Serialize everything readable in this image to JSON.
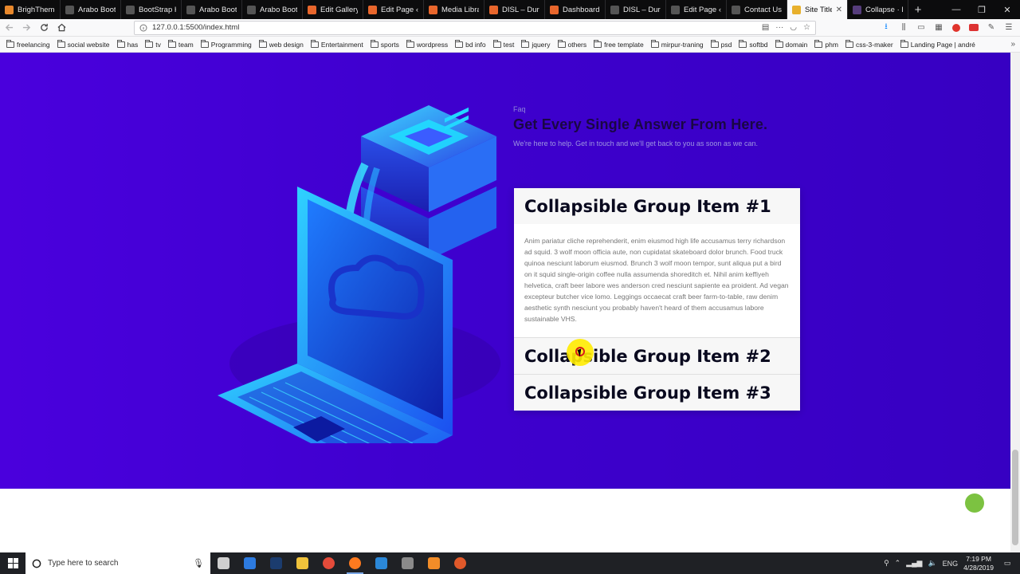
{
  "tabs": [
    {
      "title": "BrighThemes",
      "color": "#e8882c"
    },
    {
      "title": "Arabo BootStrap",
      "color": "#555555"
    },
    {
      "title": "BootStrap HTML",
      "color": "#555555"
    },
    {
      "title": "Arabo BootStrap",
      "color": "#555555"
    },
    {
      "title": "Arabo BootStrap",
      "color": "#555555"
    },
    {
      "title": "Edit Gallery",
      "color": "#e8662c"
    },
    {
      "title": "Edit Page ‹ D",
      "color": "#e8662c"
    },
    {
      "title": "Media Library",
      "color": "#e8662c"
    },
    {
      "title": "DISL – Durham",
      "color": "#e8662c"
    },
    {
      "title": "Dashboard ‹ DISL",
      "color": "#e8662c"
    },
    {
      "title": "DISL – Durham bi",
      "color": "#555555"
    },
    {
      "title": "Edit Page ‹ DISL",
      "color": "#555555"
    },
    {
      "title": "Contact Us – KM",
      "color": "#555555"
    },
    {
      "title": "Site Title",
      "color": "#e8b02c",
      "active": true
    },
    {
      "title": "Collapse · Bo",
      "color": "#563d7c"
    }
  ],
  "window_controls": {
    "minimize": "—",
    "restore": "❐",
    "close": "✕"
  },
  "url": "127.0.0.1:5500/index.html",
  "bookmarks": [
    "freelancing",
    "social website",
    "has",
    "tv",
    "team",
    "Programming",
    "web design",
    "Entertainment",
    "sports",
    "wordpress",
    "bd info",
    "test",
    "jquery",
    "others",
    "free template",
    "mirpur-traning",
    "psd",
    "softbd",
    "domain",
    "phm",
    "css-3-maker",
    "Landing Page | andré"
  ],
  "page": {
    "faq_label": "Faq",
    "title": "Get Every Single Answer From Here.",
    "subtitle": "We're here to help. Get in touch and we'll get back to you as soon as we can.",
    "accordion": [
      {
        "heading": "Collapsible Group Item #1",
        "expanded": true,
        "body": "Anim pariatur cliche reprehenderit, enim eiusmod high life accusamus terry richardson ad squid. 3 wolf moon officia aute, non cupidatat skateboard dolor brunch. Food truck quinoa nesciunt laborum eiusmod. Brunch 3 wolf moon tempor, sunt aliqua put a bird on it squid single-origin coffee nulla assumenda shoreditch et. Nihil anim keffiyeh helvetica, craft beer labore wes anderson cred nesciunt sapiente ea proident. Ad vegan excepteur butcher vice lomo. Leggings occaecat craft beer farm-to-table, raw denim aesthetic synth nesciunt you probably haven't heard of them accusamus labore sustainable VHS."
      },
      {
        "heading": "Collapsible Group Item #2",
        "expanded": false
      },
      {
        "heading": "Collapsible Group Item #3",
        "expanded": false
      }
    ]
  },
  "taskbar": {
    "search_placeholder": "Type here to search",
    "apps": [
      {
        "name": "task-view",
        "color": "#cfcfcf"
      },
      {
        "name": "edge",
        "color": "#2d7be0"
      },
      {
        "name": "photoshop",
        "color": "#1b3c6e"
      },
      {
        "name": "file-explorer",
        "color": "#f0c23b"
      },
      {
        "name": "chrome",
        "color": "#e44b3a"
      },
      {
        "name": "firefox",
        "color": "#ff7a1f",
        "active": true
      },
      {
        "name": "vscode",
        "color": "#2b88d8"
      },
      {
        "name": "snipping",
        "color": "#8a8a8a"
      },
      {
        "name": "sublime",
        "color": "#f28c28"
      },
      {
        "name": "skype",
        "color": "#e0592a"
      }
    ],
    "language": "ENG",
    "time": "7:19 PM",
    "date": "4/28/2019"
  },
  "colors": {
    "hero_background": "#4200d6",
    "accent_green": "#7cc241",
    "title_color": "#1a0744"
  }
}
